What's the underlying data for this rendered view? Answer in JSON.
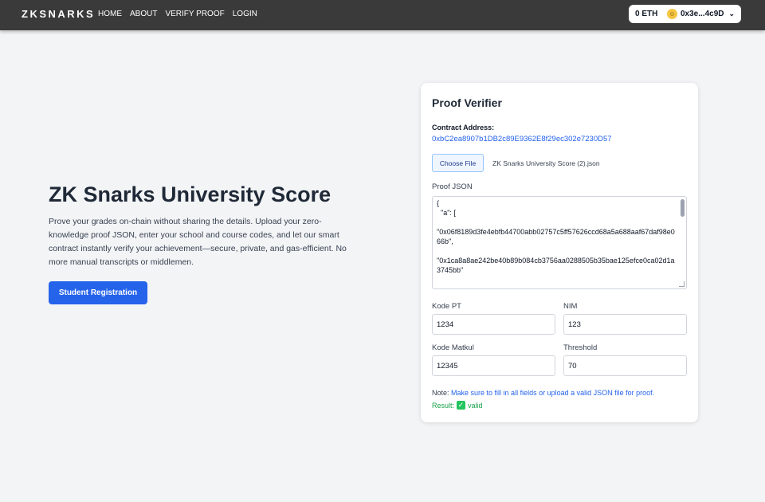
{
  "navbar": {
    "brand": "ZKSNARKS",
    "links": [
      "HOME",
      "ABOUT",
      "VERIFY PROOF",
      "LOGIN"
    ],
    "wallet": {
      "balance": "0 ETH",
      "account": "0x3e...4c9D"
    }
  },
  "hero": {
    "title": "ZK Snarks University Score",
    "description": "Prove your grades on-chain without sharing the details. Upload your zero-knowledge proof JSON, enter your school and course codes, and let our smart contract instantly verify your achievement—secure, private, and gas-efficient. No more manual transcripts or middlemen.",
    "button": "Student Registration"
  },
  "verifier": {
    "title": "Proof Verifier",
    "contract_label": "Contract Address:",
    "contract_address": "0xbC2ea8907b1DB2c89E9362E8f29ec302e7230D57",
    "choose_file": "Choose File",
    "file_name": "ZK Snarks University Score (2).json",
    "proof_label": "Proof JSON",
    "proof_json": "{\n  \"a\": [\n\n\"0x06f8189d3fe4ebfb44700abb02757c5ff57626ccd68a5a688aaf67daf98e066b\",\n\n\"0x1ca8a8ae242be40b89b084cb3756aa0288505b35bae125efce0ca02d1a3745bb\"",
    "fields": {
      "kode_pt": {
        "label": "Kode PT",
        "value": "1234"
      },
      "nim": {
        "label": "NIM",
        "value": "123"
      },
      "kode_matkul": {
        "label": "Kode Matkul",
        "value": "12345"
      },
      "threshold": {
        "label": "Threshold",
        "value": "70"
      }
    },
    "note_prefix": "Note:",
    "note_text": "Make sure to fill in all fields or upload a valid JSON file for proof.",
    "result_prefix": "Result:",
    "result_value": "valid"
  },
  "colors": {
    "accent": "#2563eb",
    "navbar": "#3a3a3a",
    "success": "#16a34a"
  }
}
